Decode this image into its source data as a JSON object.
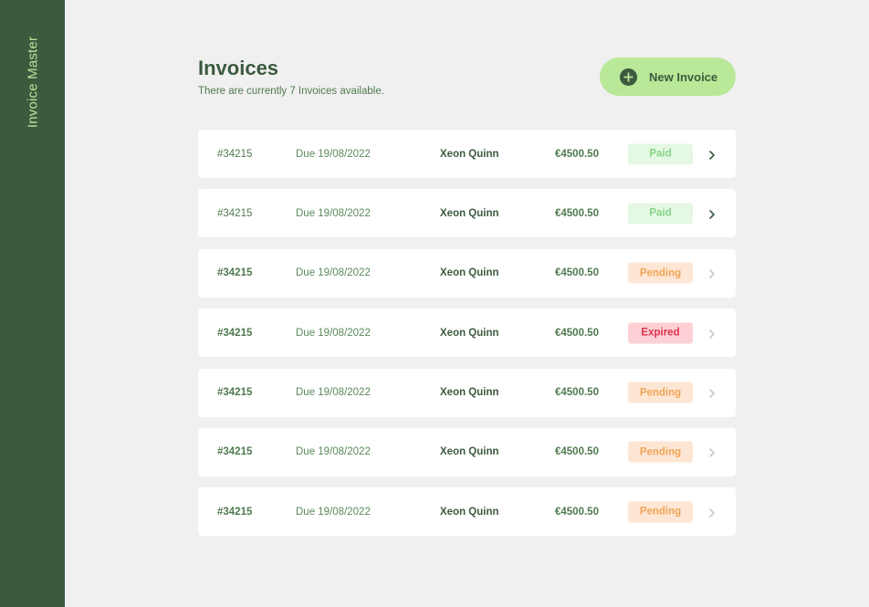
{
  "app": {
    "title": "Invoice Master"
  },
  "header": {
    "title": "Invoices",
    "subtitle": "There are currently 7 Invoices available.",
    "new_button_label": "New Invoice",
    "new_button_icon": "plus-circle-icon"
  },
  "colors": {
    "sidebar": "#3b5a3e",
    "accent": "#b9e898",
    "paid_bg": "#e4f8e4",
    "paid_text": "#86d486",
    "pending_bg": "#fde6d4",
    "pending_text": "#f0a556",
    "expired_bg": "#fcd0d5",
    "expired_text": "#e0324f"
  },
  "invoices": [
    {
      "id": "#34215",
      "due": "Due 19/08/2022",
      "client": "Xeon Quinn",
      "amount": "€4500.50",
      "status": "Paid"
    },
    {
      "id": "#34215",
      "due": "Due 19/08/2022",
      "client": "Xeon Quinn",
      "amount": "€4500.50",
      "status": "Paid"
    },
    {
      "id": "#34215",
      "due": "Due 19/08/2022",
      "client": "Xeon Quinn",
      "amount": "€4500.50",
      "status": "Pending"
    },
    {
      "id": "#34215",
      "due": "Due 19/08/2022",
      "client": "Xeon Quinn",
      "amount": "€4500.50",
      "status": "Expired"
    },
    {
      "id": "#34215",
      "due": "Due 19/08/2022",
      "client": "Xeon Quinn",
      "amount": "€4500.50",
      "status": "Pending"
    },
    {
      "id": "#34215",
      "due": "Due 19/08/2022",
      "client": "Xeon Quinn",
      "amount": "€4500.50",
      "status": "Pending"
    },
    {
      "id": "#34215",
      "due": "Due 19/08/2022",
      "client": "Xeon Quinn",
      "amount": "€4500.50",
      "status": "Pending"
    }
  ]
}
